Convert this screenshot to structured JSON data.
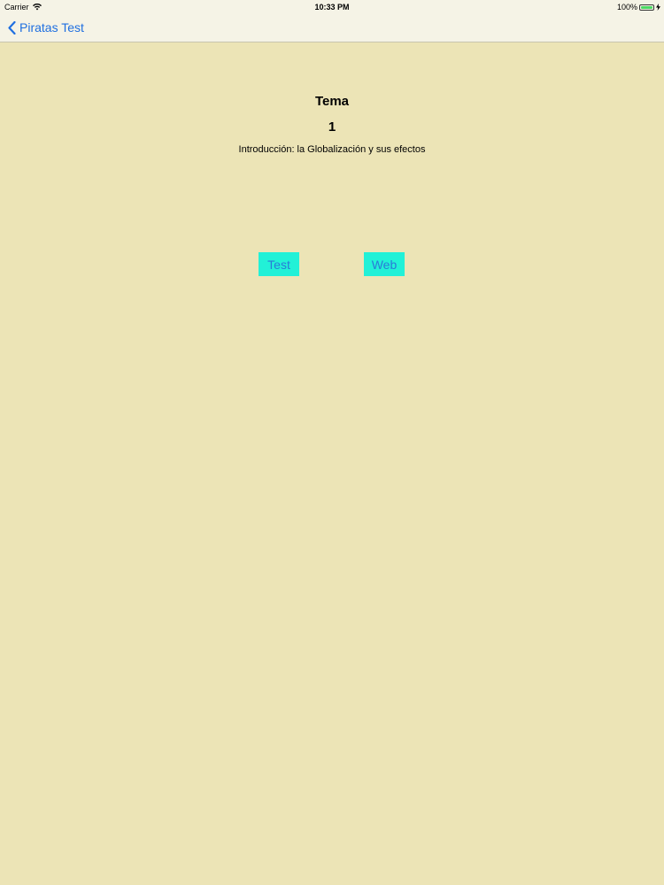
{
  "status_bar": {
    "carrier": "Carrier",
    "time": "10:33 PM",
    "battery": "100%",
    "battery_color": "#4cd964"
  },
  "nav": {
    "back_label": "Piratas Test",
    "back_icon": "chevron-left-icon",
    "accent": "#1f6fe0"
  },
  "content": {
    "title": "Tema",
    "number": "1",
    "subtitle": "Introducción: la Globalización y sus efectos"
  },
  "buttons": {
    "test_label": "Test",
    "web_label": "Web",
    "background": "#22f1d7"
  }
}
